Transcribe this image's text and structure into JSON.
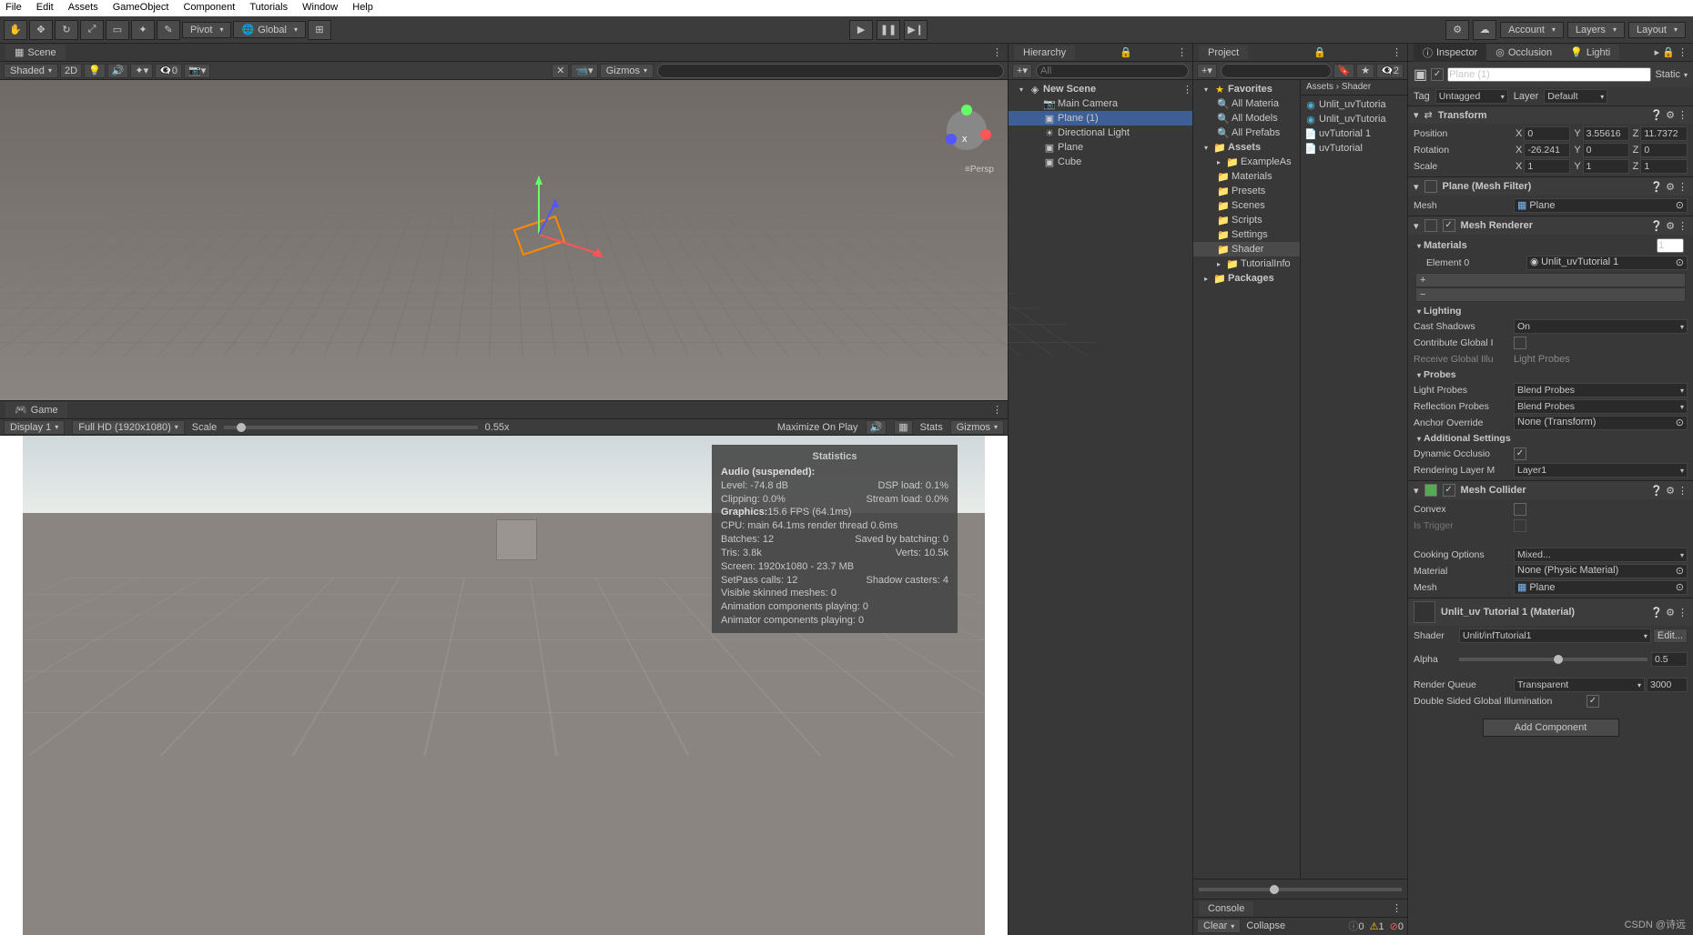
{
  "menubar": [
    "File",
    "Edit",
    "Assets",
    "GameObject",
    "Component",
    "Tutorials",
    "Window",
    "Help"
  ],
  "toolbar": {
    "pivot": "Pivot",
    "global": "Global",
    "account": "Account",
    "layers": "Layers",
    "layout": "Layout"
  },
  "scene": {
    "tab": "Scene",
    "shading": "Shaded",
    "mode2d": "2D",
    "gizmos": "Gizmos",
    "searchPlaceholder": "",
    "persp": "≡Persp",
    "hiddenCount": "0",
    "layer2": "2"
  },
  "game": {
    "tab": "Game",
    "display": "Display 1",
    "resolution": "Full HD (1920x1080)",
    "scaleLabel": "Scale",
    "scaleValue": "0.55x",
    "maximize": "Maximize On Play",
    "stats": "Stats",
    "gizmos": "Gizmos"
  },
  "statistics": {
    "title": "Statistics",
    "audio": "Audio (suspended):",
    "level": "Level: -74.8 dB",
    "dsp": "DSP load: 0.1%",
    "clipping": "Clipping: 0.0%",
    "stream": "Stream load: 0.0%",
    "graphics": "Graphics:",
    "fps": "15.6 FPS (64.1ms)",
    "cpu": "CPU: main 64.1ms  render thread 0.6ms",
    "batches": "Batches: 12",
    "saved": "Saved by batching: 0",
    "tris": "Tris: 3.8k",
    "verts": "Verts: 10.5k",
    "screen": "Screen: 1920x1080 - 23.7 MB",
    "setpass": "SetPass calls: 12",
    "shadow": "Shadow casters: 4",
    "skinned": "Visible skinned meshes: 0",
    "anim1": "Animation components playing: 0",
    "anim2": "Animator components playing: 0"
  },
  "hierarchy": {
    "tab": "Hierarchy",
    "searchPlaceholder": "All",
    "scene": "New Scene",
    "items": [
      "Main Camera",
      "Plane (1)",
      "Directional Light",
      "Plane",
      "Cube"
    ]
  },
  "project": {
    "tab": "Project",
    "breadcrumb": "Assets › Shader",
    "favorites": "Favorites",
    "favItems": [
      "All Materia",
      "All Models",
      "All Prefabs"
    ],
    "assets": "Assets",
    "folders": [
      "ExampleAs",
      "Materials",
      "Presets",
      "Scenes",
      "Scripts",
      "Settings",
      "Shader",
      "TutorialInfo"
    ],
    "packages": "Packages",
    "files": [
      "Unlit_uvTutoria",
      "Unlit_uvTutoria",
      "uvTutorial 1",
      "uvTutorial"
    ]
  },
  "console": {
    "tab": "Console",
    "clear": "Clear",
    "collapse": "Collapse",
    "info": "0",
    "warn": "1",
    "err": "0"
  },
  "inspector": {
    "tab": "Inspector",
    "occlusionTab": "Occlusion",
    "lightTab": "Lighti",
    "objName": "Plane (1)",
    "static": "Static",
    "tagLabel": "Tag",
    "tagValue": "Untagged",
    "layerLabel": "Layer",
    "layerValue": "Default",
    "transform": {
      "title": "Transform",
      "position": "Position",
      "px": "0",
      "py": "3.55616",
      "pz": "11.7372",
      "rotation": "Rotation",
      "rx": "-26.241",
      "ry": "0",
      "rz": "0",
      "scale": "Scale",
      "sx": "1",
      "sy": "1",
      "sz": "1"
    },
    "meshFilter": {
      "title": "Plane (Mesh Filter)",
      "meshLabel": "Mesh",
      "meshValue": "Plane"
    },
    "meshRenderer": {
      "title": "Mesh Renderer",
      "materials": "Materials",
      "matCount": "1",
      "element": "Element 0",
      "elementVal": "Unlit_uvTutorial 1",
      "lighting": "Lighting",
      "castShadows": "Cast Shadows",
      "castVal": "On",
      "contribGI": "Contribute Global I",
      "receiveGI": "Receive Global Illu",
      "receiveVal": "Light Probes",
      "probes": "Probes",
      "lightProbes": "Light Probes",
      "lightProbesVal": "Blend Probes",
      "reflProbes": "Reflection Probes",
      "reflProbesVal": "Blend Probes",
      "anchor": "Anchor Override",
      "anchorVal": "None (Transform)",
      "additional": "Additional Settings",
      "dynOccl": "Dynamic Occlusio",
      "renderLayer": "Rendering Layer M",
      "renderLayerVal": "Layer1"
    },
    "meshCollider": {
      "title": "Mesh Collider",
      "convex": "Convex",
      "isTrigger": "Is Trigger",
      "cooking": "Cooking Options",
      "cookingVal": "Mixed...",
      "material": "Material",
      "materialVal": "None (Physic Material)",
      "meshLabel": "Mesh",
      "meshVal": "Plane"
    },
    "material": {
      "title": "Unlit_uv Tutorial 1 (Material)",
      "shaderLabel": "Shader",
      "shaderVal": "Unlit/infTutorial1",
      "editBtn": "Edit...",
      "alpha": "Alpha",
      "alphaVal": "0.5",
      "renderQueue": "Render Queue",
      "renderQueueVal": "Transparent",
      "renderQueueNum": "3000",
      "doubleSided": "Double Sided Global Illumination"
    },
    "addComponent": "Add Component"
  },
  "watermark": "CSDN @诗远"
}
